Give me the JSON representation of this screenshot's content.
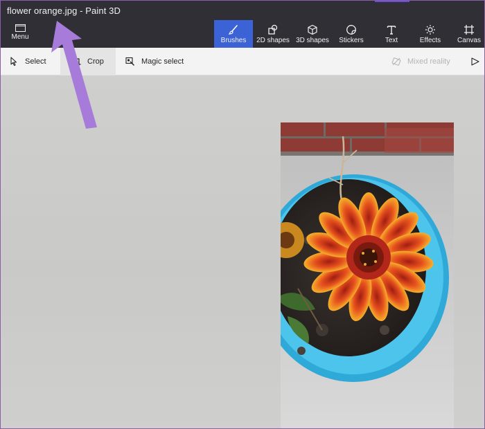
{
  "window": {
    "title": "flower orange.jpg - Paint 3D"
  },
  "ribbon": {
    "menu_label": "Menu",
    "tools": [
      {
        "label": "Brushes",
        "icon": "brush-icon",
        "active": true
      },
      {
        "label": "2D shapes",
        "icon": "2d-shapes-icon",
        "active": false
      },
      {
        "label": "3D shapes",
        "icon": "3d-cube-icon",
        "active": false
      },
      {
        "label": "Stickers",
        "icon": "sticker-icon",
        "active": false
      },
      {
        "label": "Text",
        "icon": "text-icon",
        "active": false
      },
      {
        "label": "Effects",
        "icon": "sun-effects-icon",
        "active": false
      },
      {
        "label": "Canvas",
        "icon": "canvas-grid-icon",
        "active": false
      }
    ]
  },
  "subtoolbar": {
    "select_label": "Select",
    "crop_label": "Crop",
    "magic_select_label": "Magic select",
    "mixed_reality_label": "Mixed reality"
  },
  "colors": {
    "accent": "#3b63d6",
    "annotation_arrow": "#a77bd9",
    "window_border": "#8a5fa8"
  },
  "annotation": {
    "type": "arrow",
    "points_to": "window title"
  }
}
